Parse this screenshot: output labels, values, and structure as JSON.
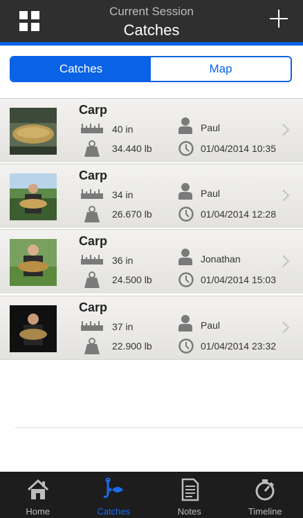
{
  "header": {
    "subtitle": "Current Session",
    "title": "Catches"
  },
  "segment": {
    "options": [
      "Catches",
      "Map"
    ],
    "selected": "Catches"
  },
  "catches": [
    {
      "species": "Carp",
      "length": "40 in",
      "weight": "34.440 lb",
      "angler": "Paul",
      "datetime": "01/04/2014 10:35"
    },
    {
      "species": "Carp",
      "length": "34 in",
      "weight": "26.670 lb",
      "angler": "Paul",
      "datetime": "01/04/2014 12:28"
    },
    {
      "species": "Carp",
      "length": "36 in",
      "weight": "24.500 lb",
      "angler": "Jonathan",
      "datetime": "01/04/2014 15:03"
    },
    {
      "species": "Carp",
      "length": "37 in",
      "weight": "22.900 lb",
      "angler": "Paul",
      "datetime": "01/04/2014 23:32"
    }
  ],
  "tabbar": {
    "tabs": [
      {
        "label": "Home",
        "icon": "home-icon"
      },
      {
        "label": "Catches",
        "icon": "catches-icon"
      },
      {
        "label": "Notes",
        "icon": "notes-icon"
      },
      {
        "label": "Timeline",
        "icon": "timeline-icon"
      }
    ],
    "active": "Catches"
  },
  "colors": {
    "accent": "#0a62e6",
    "header_bg": "#2f2f2f",
    "tabbar_bg": "#1d1d1d"
  }
}
